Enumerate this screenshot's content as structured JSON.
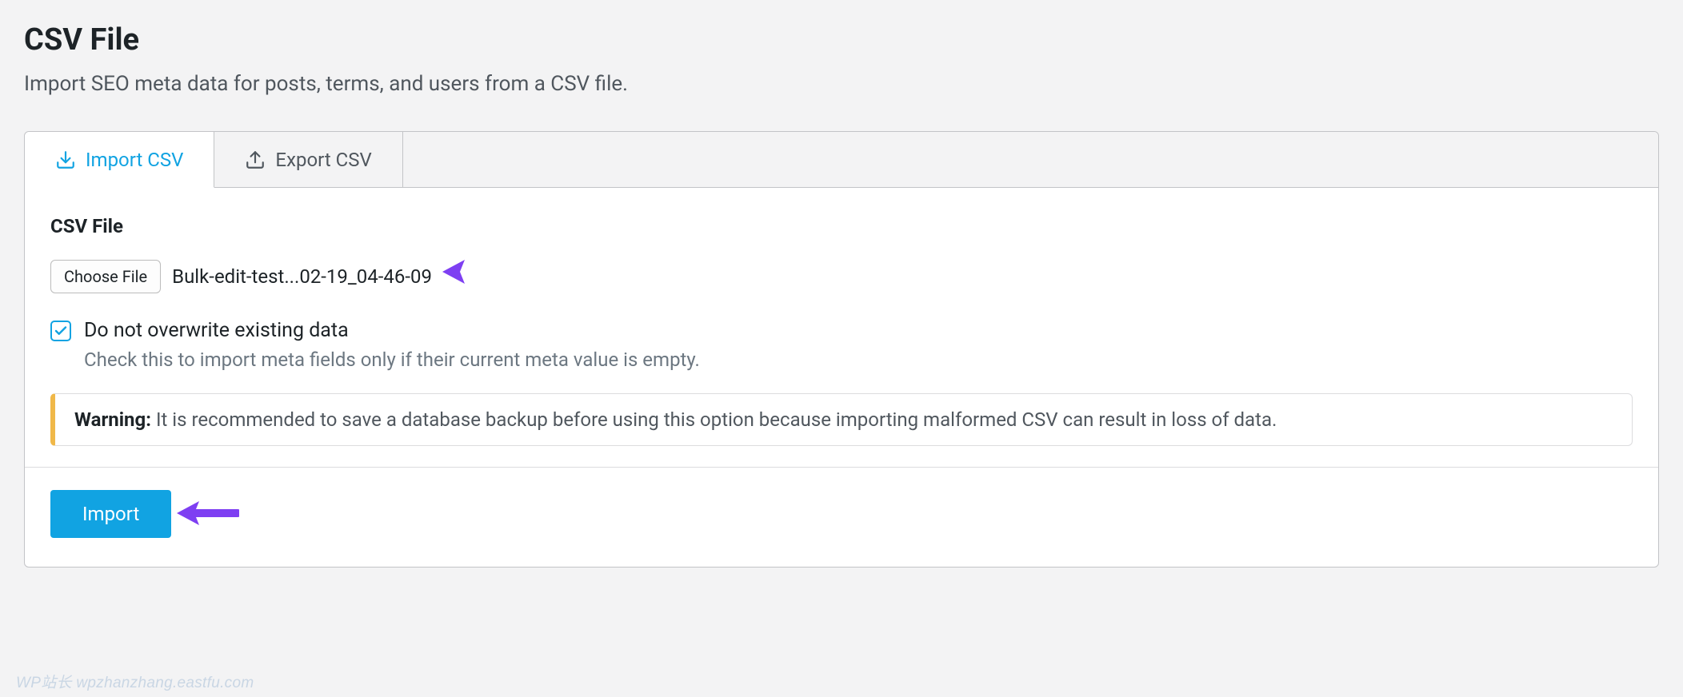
{
  "header": {
    "title": "CSV File",
    "subtitle": "Import SEO meta data for posts, terms, and users from a CSV file."
  },
  "tabs": {
    "import": "Import CSV",
    "export": "Export CSV"
  },
  "form": {
    "field_label": "CSV File",
    "choose_file_label": "Choose File",
    "selected_file": "Bulk-edit-test...02-19_04-46-09",
    "checkbox_label": "Do not overwrite existing data",
    "checkbox_help": "Check this to import meta fields only if their current meta value is empty.",
    "checkbox_checked": true
  },
  "warning": {
    "prefix": "Warning:",
    "text": " It is recommended to save a database backup before using this option because importing malformed CSV can result in loss of data."
  },
  "footer": {
    "import_label": "Import"
  },
  "watermark": "WP站长  wpzhanzhang.eastfu.com",
  "colors": {
    "accent": "#11a3e2",
    "warning_border": "#f0b849",
    "arrow": "#7e3ff2"
  }
}
